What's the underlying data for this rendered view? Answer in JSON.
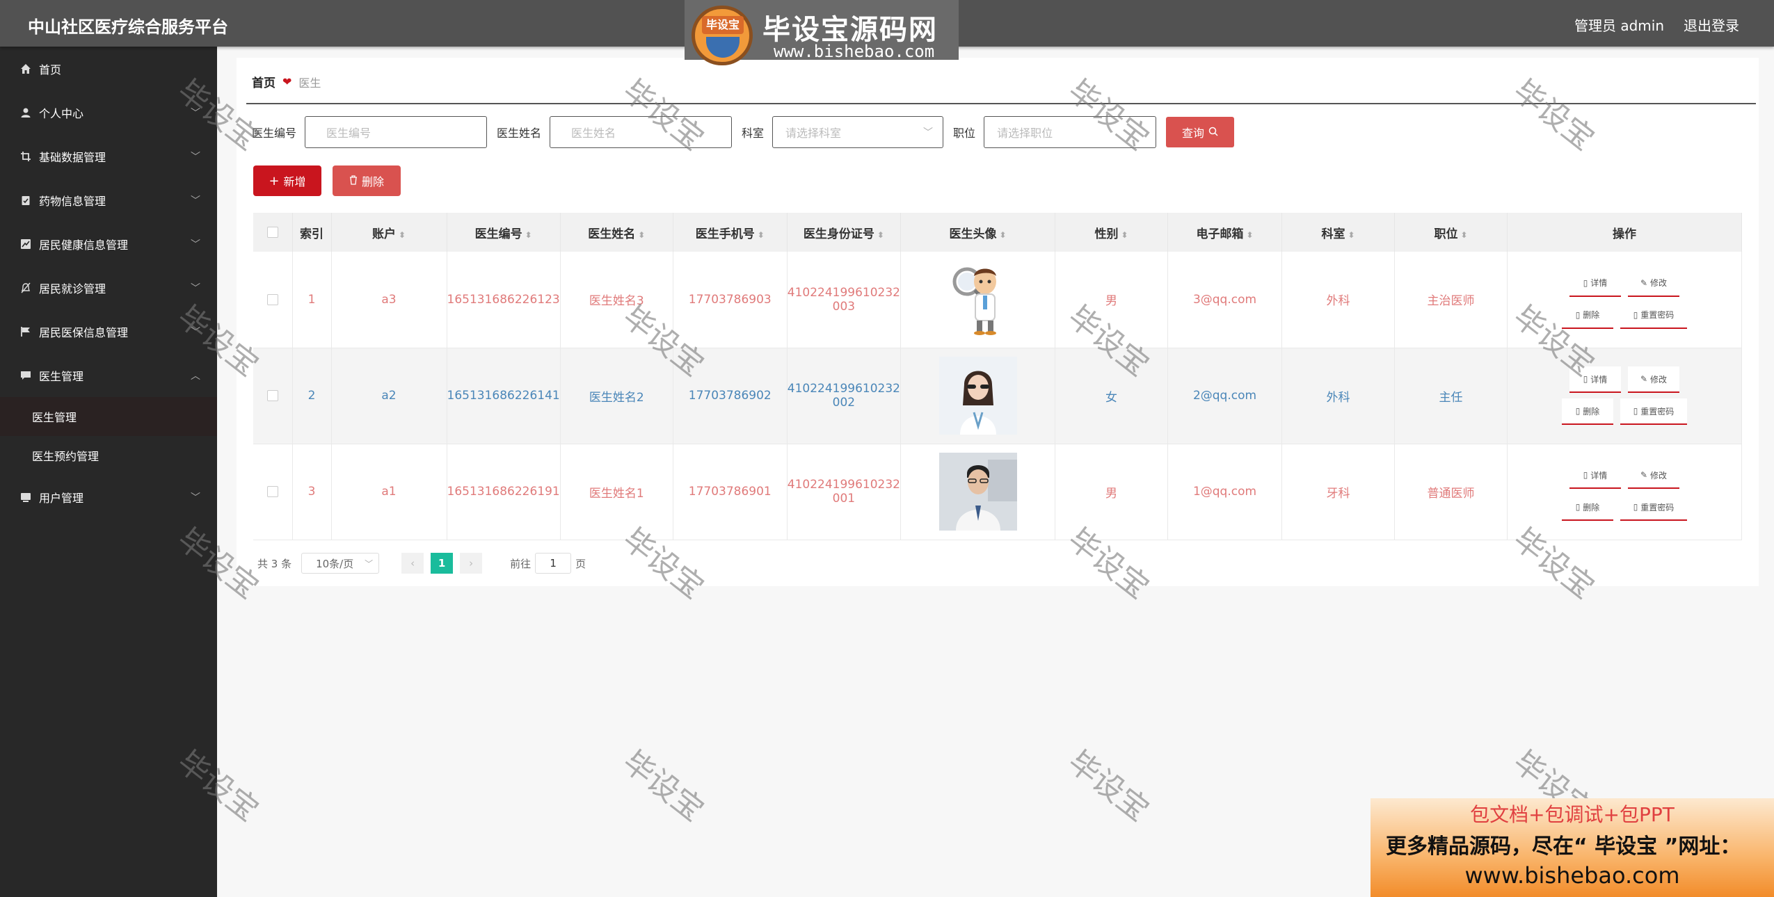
{
  "header": {
    "app_title": "中山社区医疗综合服务平台",
    "user_label": "管理员 admin",
    "logout": "退出登录"
  },
  "logo_overlay": {
    "badge_text": "毕设宝",
    "title": "毕设宝源码网",
    "url": "www.bishebao.com"
  },
  "sidebar": {
    "items": [
      {
        "label": "首页",
        "icon": "home-icon"
      },
      {
        "label": "个人中心",
        "icon": "user-icon"
      },
      {
        "label": "基础数据管理",
        "icon": "crop-icon"
      },
      {
        "label": "药物信息管理",
        "icon": "clipboard-icon"
      },
      {
        "label": "居民健康信息管理",
        "icon": "chart-icon"
      },
      {
        "label": "居民就诊管理",
        "icon": "bell-icon"
      },
      {
        "label": "居民医保信息管理",
        "icon": "flag-icon"
      },
      {
        "label": "医生管理",
        "icon": "chat-icon",
        "expanded": true
      },
      {
        "label": "用户管理",
        "icon": "user-card-icon"
      }
    ],
    "sub_items": [
      {
        "label": "医生管理",
        "active": true
      },
      {
        "label": "医生预约管理",
        "active": false
      }
    ]
  },
  "breadcrumb": {
    "home": "首页",
    "current": "医生"
  },
  "search": {
    "doctor_code_label": "医生编号",
    "doctor_code_placeholder": "医生编号",
    "doctor_name_label": "医生姓名",
    "doctor_name_placeholder": "医生姓名",
    "dept_label": "科室",
    "dept_placeholder": "请选择科室",
    "position_label": "职位",
    "position_placeholder": "请选择职位",
    "query_button": "查询"
  },
  "toolbar": {
    "add_label": "新增",
    "delete_label": "删除"
  },
  "table": {
    "columns": [
      "索引",
      "账户",
      "医生编号",
      "医生姓名",
      "医生手机号",
      "医生身份证号",
      "医生头像",
      "性别",
      "电子邮箱",
      "科室",
      "职位",
      "操作"
    ],
    "rows": [
      {
        "index": "1",
        "account": "a3",
        "code": "165131686226123",
        "name": "医生姓名3",
        "phone": "17703786903",
        "id_line1": "410224199610232",
        "id_line2": "003",
        "gender": "男",
        "email": "3@qq.com",
        "dept": "外科",
        "position": "主治医师"
      },
      {
        "index": "2",
        "account": "a2",
        "code": "165131686226141",
        "name": "医生姓名2",
        "phone": "17703786902",
        "id_line1": "410224199610232",
        "id_line2": "002",
        "gender": "女",
        "email": "2@qq.com",
        "dept": "外科",
        "position": "主任"
      },
      {
        "index": "3",
        "account": "a1",
        "code": "165131686226191",
        "name": "医生姓名1",
        "phone": "17703786901",
        "id_line1": "410224199610232",
        "id_line2": "001",
        "gender": "男",
        "email": "1@qq.com",
        "dept": "牙科",
        "position": "普通医师"
      }
    ],
    "ops": {
      "detail": "详情",
      "edit": "修改",
      "delete": "删除",
      "reset_password": "重置密码"
    }
  },
  "pagination": {
    "total": "共 3 条",
    "page_size": "10条/页",
    "current_page": "1",
    "goto_label": "前往",
    "goto_value": "1",
    "page_unit": "页"
  },
  "watermark": "毕设宝",
  "banner": {
    "line1": "包文档+包调试+包PPT",
    "line2": "更多精品源码，尽在“ 毕设宝 ”网址：",
    "line3": "www.bishebao.com"
  },
  "colors": {
    "brand_red": "#c9151e",
    "query_red": "#d9524f",
    "header_bg": "#525252",
    "sidebar_bg": "#282828",
    "page_active": "#1abc9c",
    "row_odd_text": "#e07a7a",
    "row_even_text": "#4a86b8"
  }
}
